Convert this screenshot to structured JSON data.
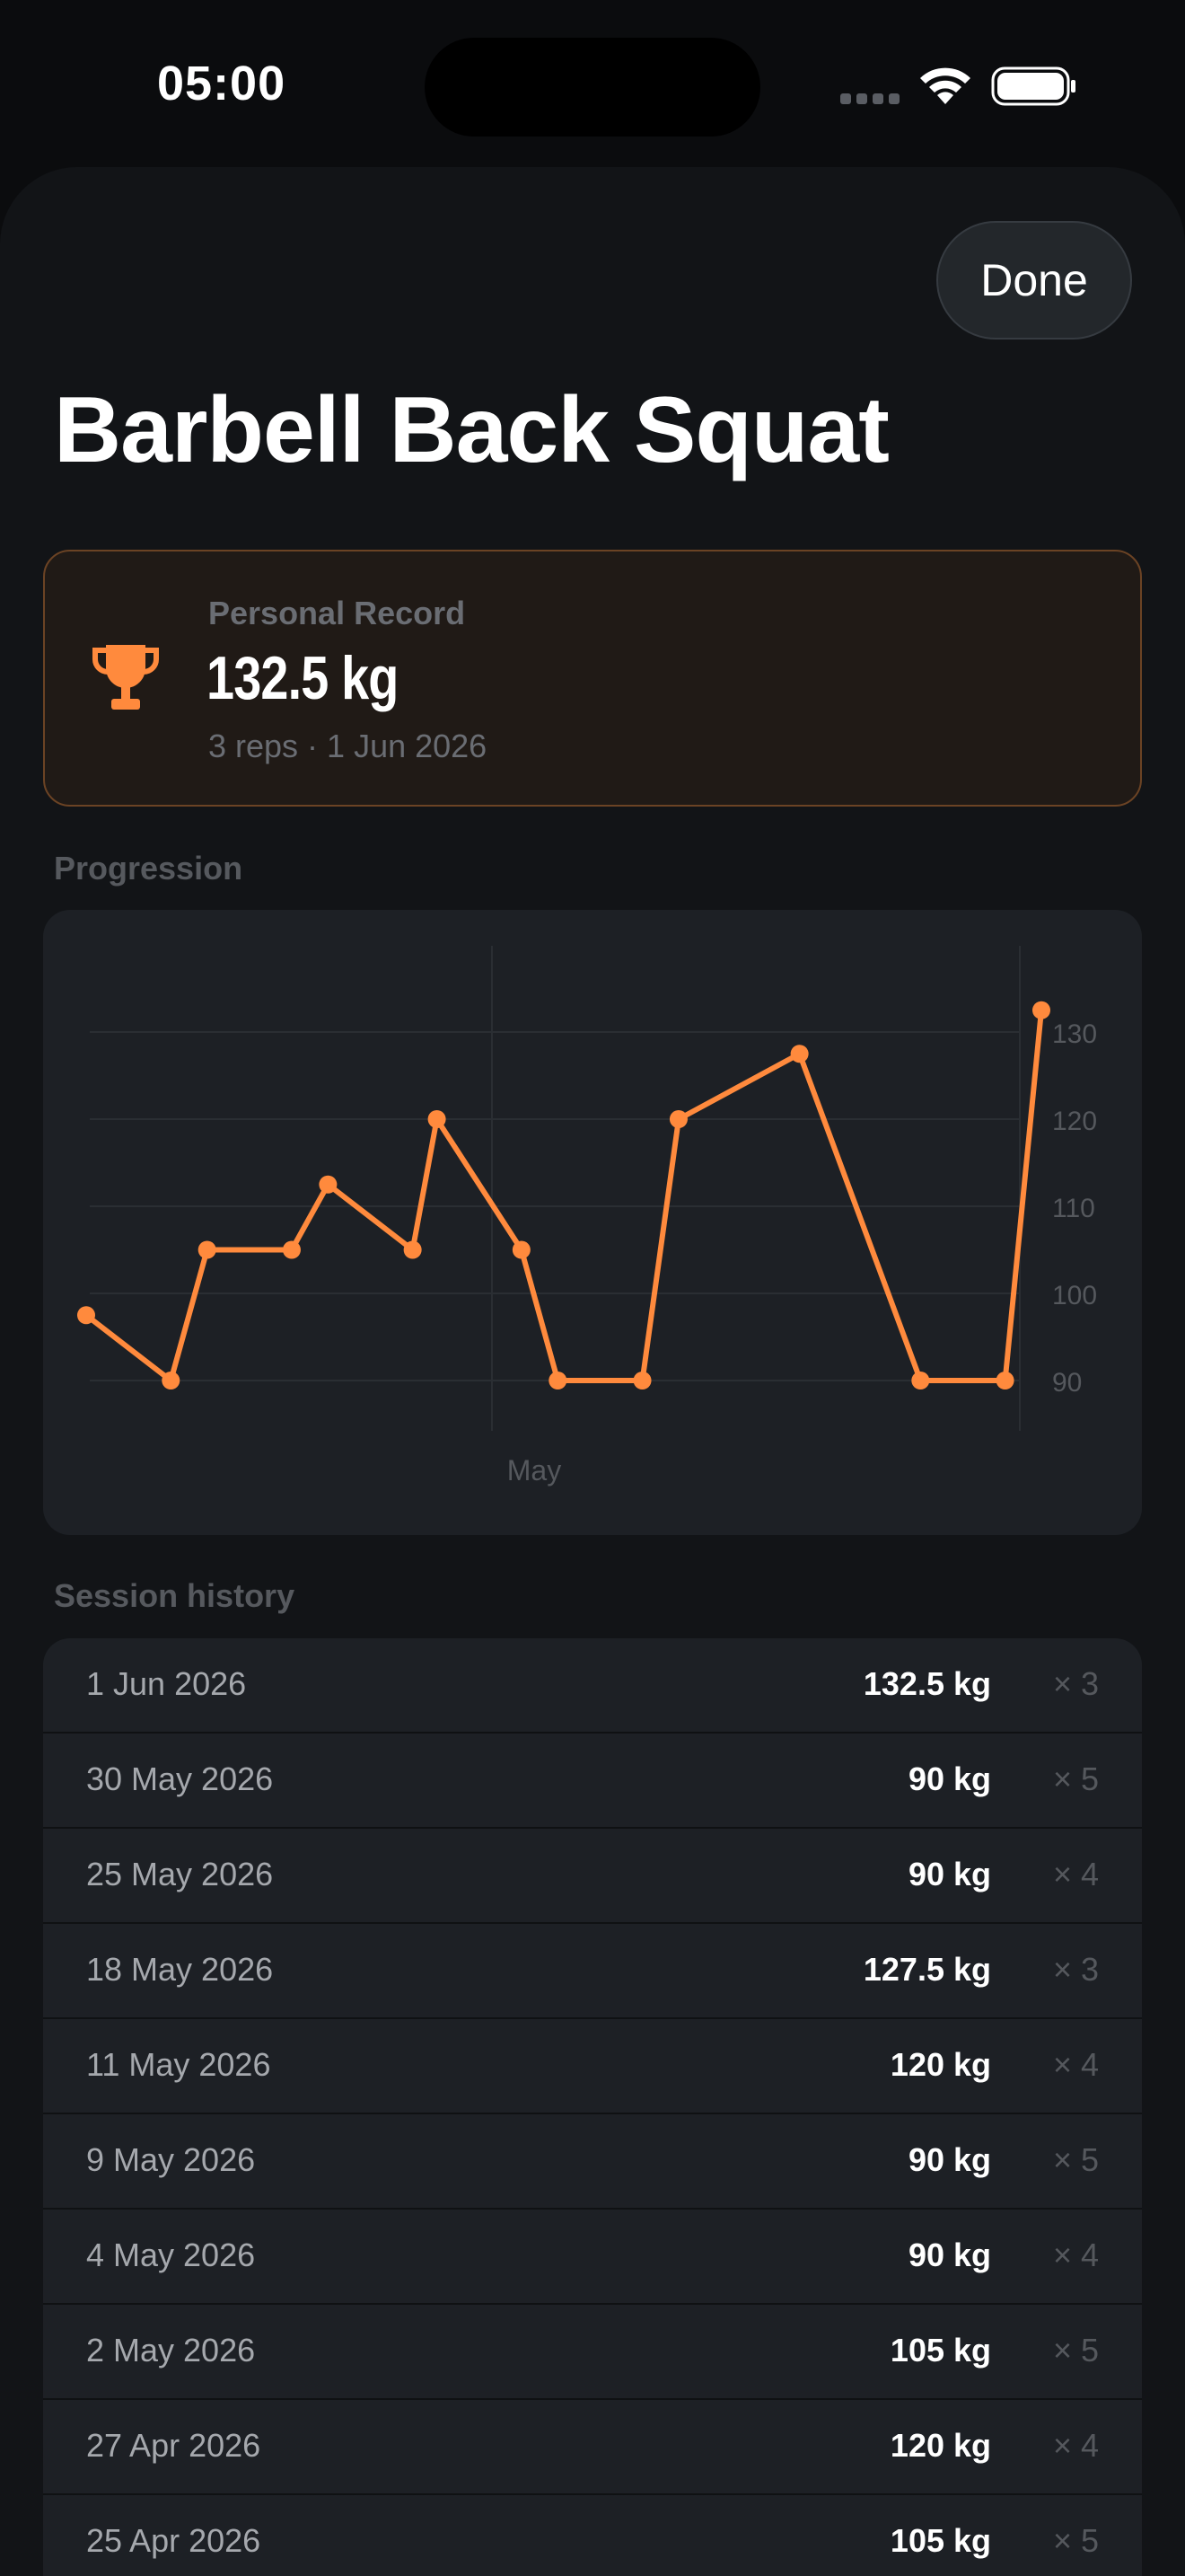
{
  "status_bar": {
    "time": "05:00"
  },
  "header": {
    "done_label": "Done",
    "title": "Barbell Back Squat"
  },
  "personal_record": {
    "label": "Personal Record",
    "value": "132.5 kg",
    "detail": "3 reps · 1 Jun 2026",
    "accent": "#ff8a3d"
  },
  "progression": {
    "section_label": "Progression"
  },
  "chart_data": {
    "type": "line",
    "color": "#ff8a3d",
    "x_tick_labels": [
      "May"
    ],
    "y_ticks": [
      90,
      100,
      110,
      120,
      130
    ],
    "ylim": [
      80,
      133
    ],
    "grid": true,
    "points": [
      {
        "day": 0,
        "y": 97.5
      },
      {
        "day": 7,
        "y": 90
      },
      {
        "day": 10,
        "y": 105
      },
      {
        "day": 17,
        "y": 105
      },
      {
        "day": 20,
        "y": 112.5
      },
      {
        "day": 27,
        "y": 105
      },
      {
        "day": 29,
        "y": 120
      },
      {
        "day": 36,
        "y": 105
      },
      {
        "day": 39,
        "y": 90
      },
      {
        "day": 46,
        "y": 90
      },
      {
        "day": 49,
        "y": 120
      },
      {
        "day": 59,
        "y": 127.5
      },
      {
        "day": 69,
        "y": 90
      },
      {
        "day": 76,
        "y": 90
      },
      {
        "day": 79,
        "y": 132.5
      }
    ]
  },
  "history": {
    "section_label": "Session history",
    "rows": [
      {
        "date": "1 Jun 2026",
        "weight": "132.5 kg",
        "reps": "× 3"
      },
      {
        "date": "30 May 2026",
        "weight": "90 kg",
        "reps": "× 5"
      },
      {
        "date": "25 May 2026",
        "weight": "90 kg",
        "reps": "× 4"
      },
      {
        "date": "18 May 2026",
        "weight": "127.5 kg",
        "reps": "× 3"
      },
      {
        "date": "11 May 2026",
        "weight": "120 kg",
        "reps": "× 4"
      },
      {
        "date": "9 May 2026",
        "weight": "90 kg",
        "reps": "× 5"
      },
      {
        "date": "4 May 2026",
        "weight": "90 kg",
        "reps": "× 4"
      },
      {
        "date": "2 May 2026",
        "weight": "105 kg",
        "reps": "× 5"
      },
      {
        "date": "27 Apr 2026",
        "weight": "120 kg",
        "reps": "× 4"
      },
      {
        "date": "25 Apr 2026",
        "weight": "105 kg",
        "reps": "× 5"
      }
    ]
  }
}
